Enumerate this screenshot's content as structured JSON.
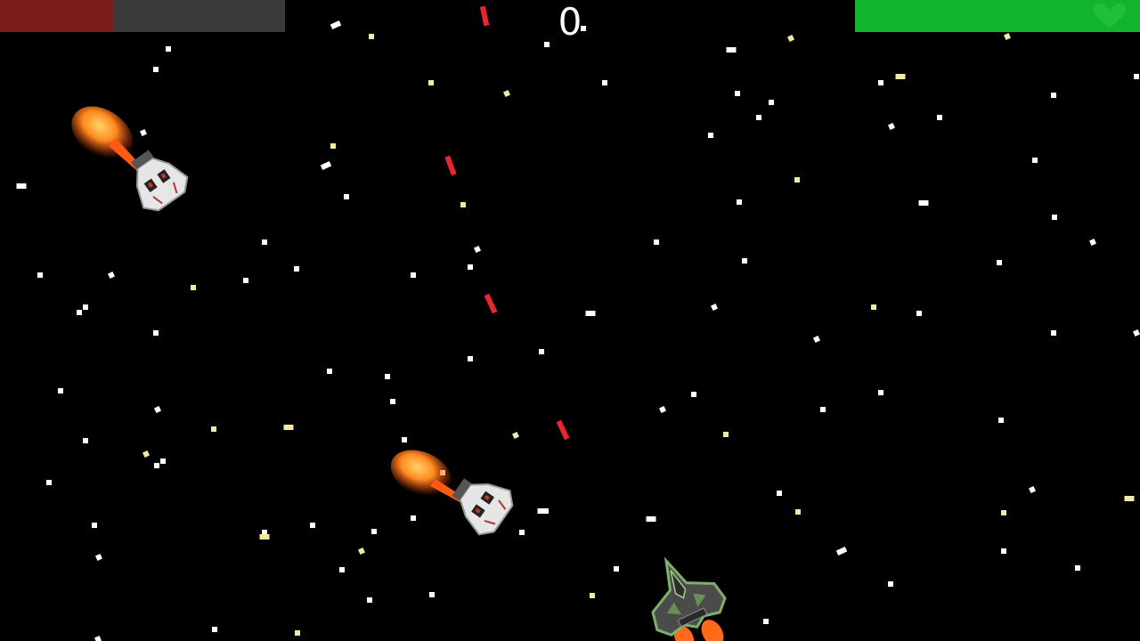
{
  "hud": {
    "score": "0",
    "enemy_health_fraction": 0.4,
    "player_health_fraction": 1.0,
    "enemy_health_color": "#7b1d1d",
    "player_health_color": "#13b42d",
    "player_health_icon": "heart-icon"
  },
  "entities": {
    "enemy_ships": 2,
    "player_ship": 1,
    "enemy_lasers": 4,
    "enemy_laser_color": "#e8262b",
    "thruster_color": "#ff7a1a"
  }
}
